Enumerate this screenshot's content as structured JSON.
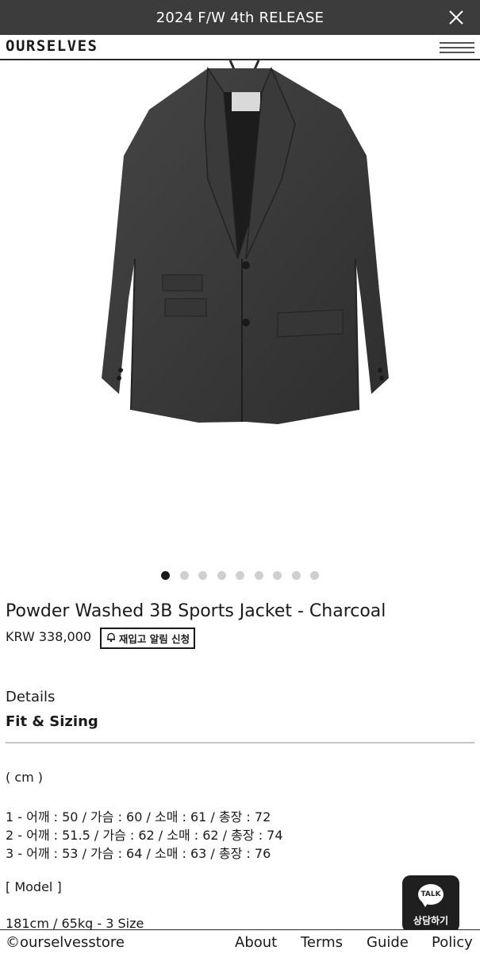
{
  "banner": {
    "text": "2024 F/W 4th RELEASE",
    "close_icon": "close-icon"
  },
  "header": {
    "logo": "OURSELVES",
    "menu_icon": "hamburger-menu-icon"
  },
  "product": {
    "title": "Powder Washed 3B Sports Jacket - Charcoal",
    "price": "KRW 338,000",
    "restock_label": "재입고 알림 신청",
    "restock_icon": "bell-icon",
    "image_alt": "Charcoal jacket product photo",
    "image_count": 9,
    "active_image": 1,
    "jacket_color": "#3b3b3b"
  },
  "info": {
    "details_label": "Details",
    "fit_label": "Fit & Sizing",
    "unit": "( cm )",
    "sizes": [
      "1 - 어깨 : 50 / 가슴 : 60 / 소매 : 61 / 총장 : 72",
      "2 - 어깨 : 51.5 / 가슴 : 62 / 소매 : 62 / 총장 : 74",
      "3 - 어깨 : 53 / 가슴 : 64 / 소매 : 63 / 총장 : 76"
    ],
    "model_header": "[ Model ]",
    "model_info": "181cm / 65kg - 3 Size"
  },
  "chat": {
    "bubble": "TALK",
    "label": "상담하기"
  },
  "footer": {
    "copyright": "©ourselvesstore",
    "links": [
      "About",
      "Terms",
      "Guide",
      "Policy"
    ]
  },
  "colors": {
    "banner_bg": "#3c3c3c",
    "dot_active": "#1a1a1a",
    "dot_inactive": "#cfcfcf"
  }
}
